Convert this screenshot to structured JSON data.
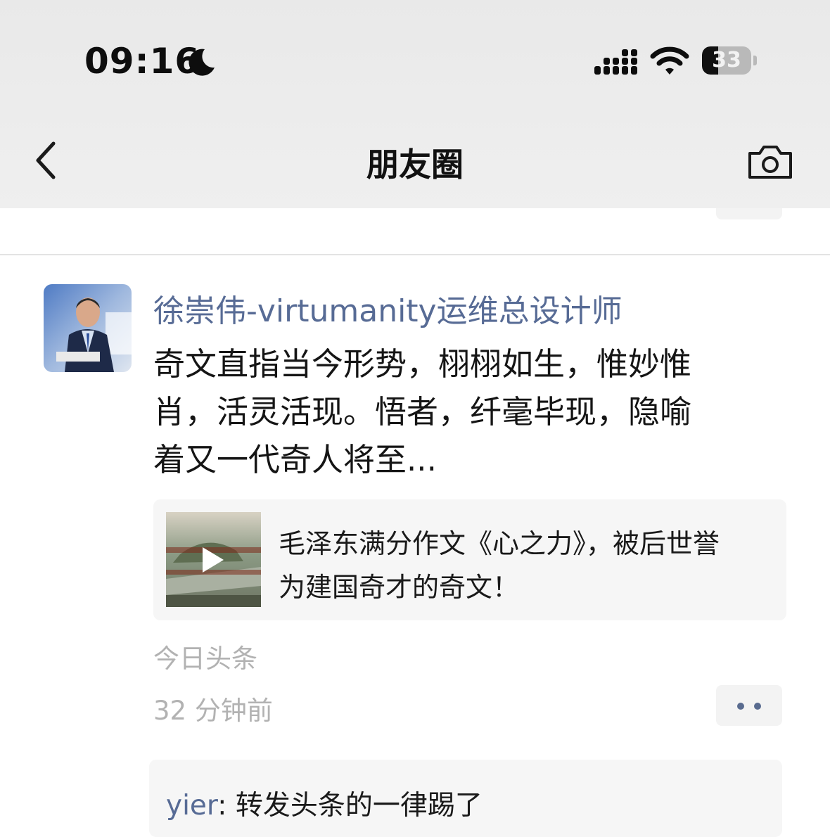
{
  "status_bar": {
    "time": "09:16",
    "battery": "33",
    "battery_level": 0.33
  },
  "nav": {
    "title": "朋友圈"
  },
  "post": {
    "author": "徐崇伟-virtumanity运维总设计师",
    "text_lines": [
      "奇文直指当今形势，栩栩如生，惟妙惟",
      "肖，活灵活现。悟者，纤毫毕现，隐喻",
      "着又一代奇人将至..."
    ],
    "share": {
      "title_lines": [
        "毛泽东满分作文《心之力》，被后世誉",
        "为建国奇才的奇文！"
      ]
    },
    "source": "今日头条",
    "time": "32 分钟前",
    "comments": [
      {
        "user": "yier",
        "separator": ": ",
        "text": "转发头条的一律踢了"
      }
    ]
  },
  "colors": {
    "link": "#576b95",
    "meta": "#b2b2b2",
    "card_bg": "#f6f6f6"
  }
}
